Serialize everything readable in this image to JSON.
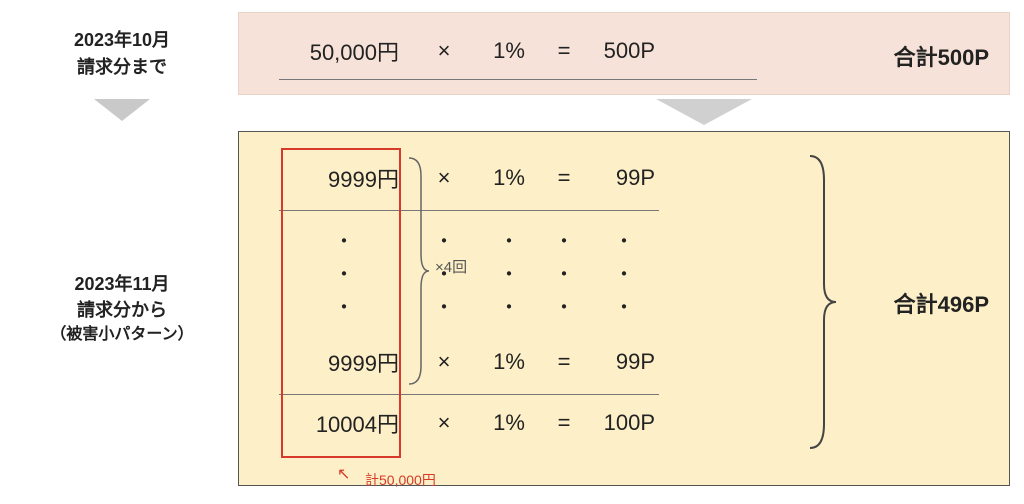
{
  "labels": {
    "top_period_l1": "2023年10月",
    "top_period_l2": "請求分まで",
    "bottom_period_l1": "2023年11月",
    "bottom_period_l2": "請求分から",
    "bottom_period_l3": "（被害小パターン）"
  },
  "top": {
    "amount": "50,000円",
    "mult": "×",
    "rate": "1%",
    "eq": "=",
    "points": "500P",
    "total": "合計500P"
  },
  "bottom": {
    "rows": [
      {
        "amount": "9999円",
        "mult": "×",
        "rate": "1%",
        "eq": "=",
        "points": "99P"
      },
      {
        "amount": "9999円",
        "mult": "×",
        "rate": "1%",
        "eq": "=",
        "points": "99P"
      },
      {
        "amount": "10004円",
        "mult": "×",
        "rate": "1%",
        "eq": "=",
        "points": "100P"
      }
    ],
    "dot": "・",
    "repeat_label": "×4回",
    "sum_caption": "計50,000円",
    "total": "合計496P"
  }
}
